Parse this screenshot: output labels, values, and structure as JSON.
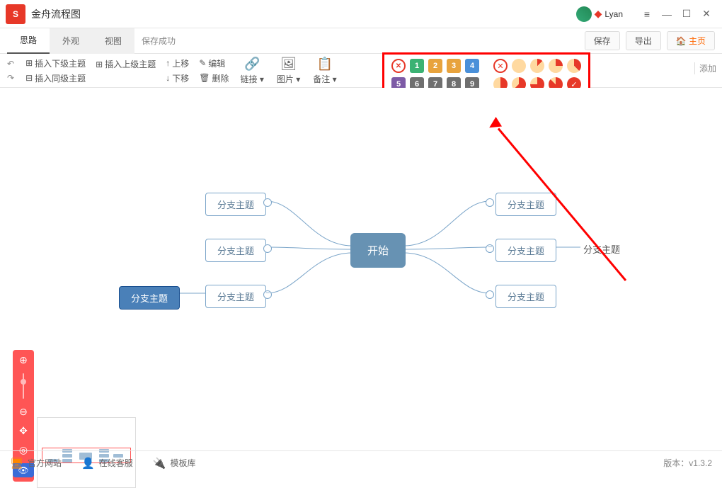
{
  "app": {
    "title": "金舟流程图",
    "user": "Lyan"
  },
  "tabs": {
    "t0": "思路",
    "t1": "外观",
    "t2": "视图",
    "status": "保存成功"
  },
  "topbtns": {
    "save": "保存",
    "export": "导出",
    "home": "主页"
  },
  "toolbar": {
    "insert_sub": "插入下级主题",
    "insert_sup": "插入上级主题",
    "insert_sib": "插入同级主题",
    "move_up": "上移",
    "move_down": "下移",
    "edit": "编辑",
    "delete": "删除",
    "link": "链接",
    "image": "图片",
    "note": "备注",
    "add": "添加"
  },
  "palette": {
    "row1": [
      "1",
      "2",
      "3",
      "4"
    ],
    "row2": [
      "5",
      "6",
      "7",
      "8",
      "9"
    ],
    "colors1": [
      "#3bb273",
      "#e8a33d",
      "#e8a33d",
      "#4a90d9"
    ],
    "colors2": [
      "#7d5ba6",
      "#6f6f6f",
      "#6f6f6f",
      "#6f6f6f",
      "#6f6f6f"
    ]
  },
  "mind": {
    "center": "开始",
    "branch": "分支主题",
    "subbranch": "分支主题"
  },
  "footer": {
    "site": "官方网站",
    "service": "在线客服",
    "templates": "模板库",
    "version": "版本：v1.3.2"
  }
}
